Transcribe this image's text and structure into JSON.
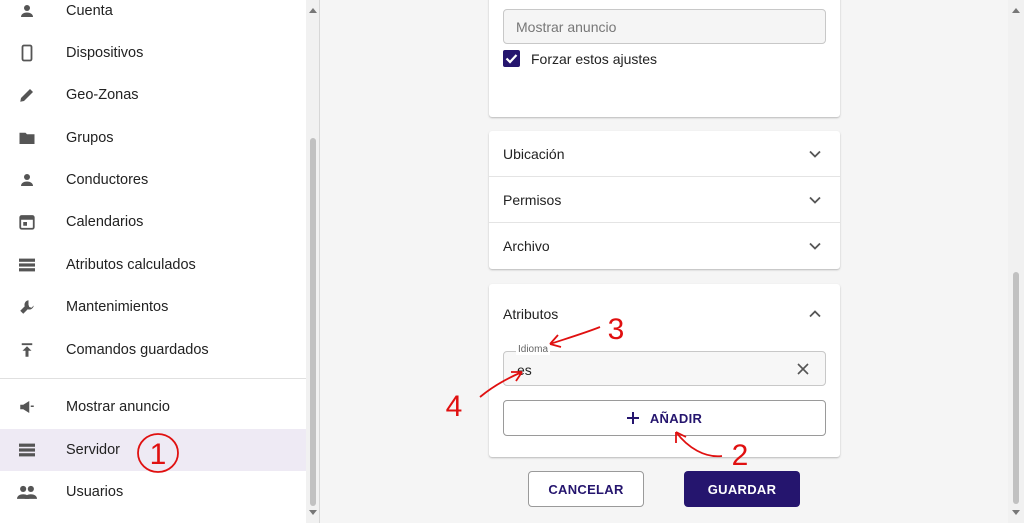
{
  "sidebar": {
    "items": [
      {
        "label": "Cuenta",
        "icon": "person-icon"
      },
      {
        "label": "Dispositivos",
        "icon": "phone-icon"
      },
      {
        "label": "Geo-Zonas",
        "icon": "pencil-icon"
      },
      {
        "label": "Grupos",
        "icon": "folder-icon"
      },
      {
        "label": "Conductores",
        "icon": "person-icon"
      },
      {
        "label": "Calendarios",
        "icon": "calendar-icon"
      },
      {
        "label": "Atributos calculados",
        "icon": "storage-icon"
      },
      {
        "label": "Mantenimientos",
        "icon": "wrench-icon"
      },
      {
        "label": "Comandos guardados",
        "icon": "publish-icon"
      },
      {
        "label": "Mostrar anuncio",
        "icon": "megaphone-icon"
      },
      {
        "label": "Servidor",
        "icon": "storage-icon",
        "active": true
      },
      {
        "label": "Usuarios",
        "icon": "people-icon"
      }
    ]
  },
  "main": {
    "announcement_placeholder": "Mostrar anuncio",
    "force_settings_label": "Forzar estos ajustes",
    "accordions": [
      "Ubicación",
      "Permisos",
      "Archivo"
    ],
    "attributes": {
      "title": "Atributos",
      "field_label": "Idioma",
      "field_value": "es",
      "add_label": "AÑADIR"
    },
    "cancel_label": "CANCELAR",
    "save_label": "GUARDAR"
  },
  "annotations": [
    "1",
    "2",
    "3",
    "4"
  ],
  "colors": {
    "accent": "#25156e",
    "annotation": "#e01010",
    "active_bg": "#eeeaf4"
  }
}
